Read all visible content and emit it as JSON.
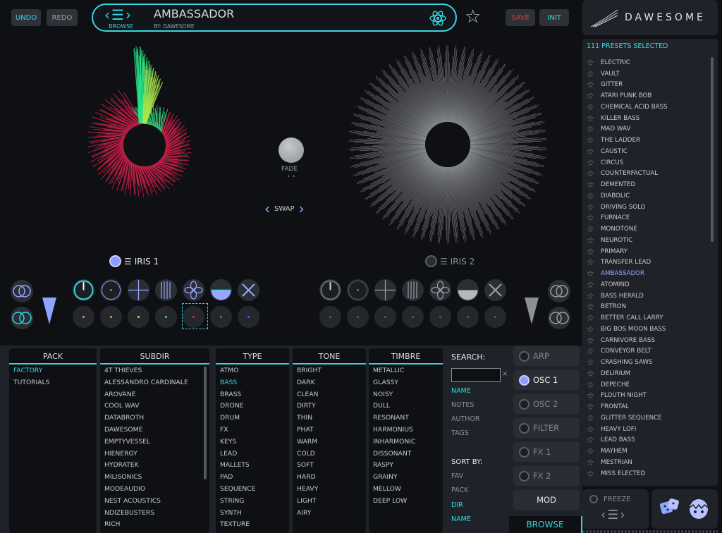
{
  "header": {
    "undo": "UNDO",
    "redo": "REDO",
    "browse_label": "BROWSE",
    "preset_title": "AMBASSADOR",
    "author": "BY:  DAWESOME",
    "save": "SAVE",
    "init": "INIT",
    "brand": "DAWESOME"
  },
  "center": {
    "fade_label": "FADE",
    "swap_label": "SWAP",
    "iris1_label": "IRIS 1",
    "iris2_label": "IRIS 2"
  },
  "colors": {
    "accent": "#35d6e0",
    "active_preset": "#9aa6ff",
    "save": "#e0383b"
  },
  "iris1_mod_dots": [
    "#e3a42a",
    "#e3a42a",
    "#e2d13a",
    "#35d6e0",
    "#e0383b",
    "#777777",
    "#5a5aff"
  ],
  "browser": {
    "pack": {
      "title": "PACK",
      "items": [
        "FACTORY",
        "TUTORIALS"
      ],
      "active": 0
    },
    "subdir": {
      "title": "SUBDIR",
      "items": [
        "4T THIEVES",
        "ALESSANDRO CARDINALE",
        "AROVANE",
        "COOL WAV",
        "DATABROTH",
        "DAWESOME",
        "EMPTYVESSEL",
        "HIENERGY",
        "HYDRATEK",
        "MILISONICS",
        "MODEAUDIO",
        "NEST ACOUSTICS",
        "NDIZEBUSTERS",
        "RICH"
      ]
    },
    "type": {
      "title": "TYPE",
      "items": [
        "ATMO",
        "BASS",
        "BRASS",
        "DRONE",
        "DRUM",
        "FX",
        "KEYS",
        "LEAD",
        "MALLETS",
        "PAD",
        "SEQUENCE",
        "STRING",
        "SYNTH",
        "TEXTURE"
      ],
      "active": 1
    },
    "tone": {
      "title": "TONE",
      "items": [
        "BRIGHT",
        "DARK",
        "CLEAN",
        "DIRTY",
        "THIN",
        "PHAT",
        "WARM",
        "COLD",
        "SOFT",
        "HARD",
        "HEAVY",
        "LIGHT",
        "AIRY"
      ]
    },
    "timbre": {
      "title": "TIMBRE",
      "items": [
        "METALLIC",
        "GLASSY",
        "NOISY",
        "DULL",
        "RESONANT",
        "HARMONIUS",
        "INHARMONIC",
        "DISSONANT",
        "RASPY",
        "GRAINY",
        "MELLOW",
        "DEEP LOW"
      ]
    }
  },
  "search": {
    "label": "SEARCH:",
    "placeholder": "",
    "clear": "×",
    "fields": [
      "NAME",
      "NOTES",
      "AUTHOR",
      "TAGS"
    ],
    "sort_label": "SORT BY:",
    "sort_options": [
      "FAV",
      "PACK",
      "DIR",
      "NAME"
    ]
  },
  "side_tabs": [
    "ARP",
    "OSC 1",
    "OSC 2",
    "FILTER",
    "FX 1",
    "FX 2"
  ],
  "mod_label": "MOD",
  "browse_tab": "BROWSE",
  "presets": {
    "count_label": "111 PRESETS SELECTED",
    "items": [
      "ELECTRIC",
      "VAULT",
      "GITTER",
      "ATARI PUNK BOB",
      "CHEMICAL ACID BASS",
      "KILLER BASS",
      "MAD WAV",
      "THE LADDER",
      "CAUSTIC",
      "CIRCUS",
      "COUNTERFACTUAL",
      "DEMENTED",
      "DIABOLIC",
      "DRIVING SOLO",
      "FURNACE",
      "MONOTONE",
      "NEUROTIC",
      "PRIMARY",
      "TRANSFER LEAD",
      "AMBASSADOR",
      "ATOMIND",
      "BASS HERALD",
      "BETRON",
      "BETTER CALL LARRY",
      "BIG BOS MOON BASS",
      "CARNIVORE BASS",
      "CONVEYOR BELT",
      "CRASHING SAWS",
      "DELIRIUM",
      "DEPECHE",
      "FLOUTH NIGHT",
      "FRONTAL",
      "GLITTER SEQUENCE",
      "HEAVY LOFI",
      "LEAD BASS",
      "MAYHEM",
      "MESTRIAN",
      "MISS ELECTED"
    ],
    "active": 19
  },
  "freeze_label": "FREEZE"
}
